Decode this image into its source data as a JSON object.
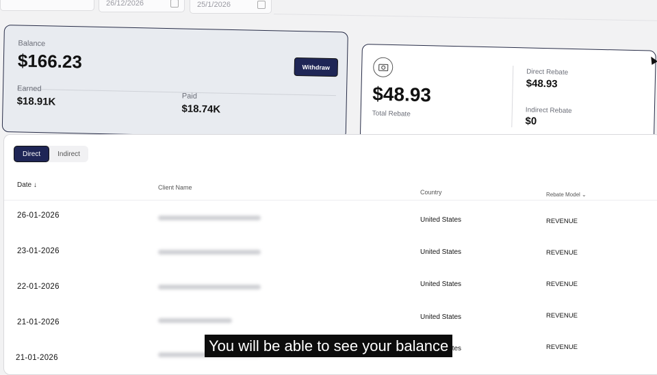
{
  "filters": {
    "start_date": "26/12/2026",
    "end_date": "25/1/2026"
  },
  "balance": {
    "label": "Balance",
    "amount": "$166.23",
    "withdraw_label": "Withdraw",
    "earned_label": "Earned",
    "earned_value": "$18.91K",
    "paid_label": "Paid",
    "paid_value": "$18.74K"
  },
  "rebate": {
    "total_value": "$48.93",
    "total_label": "Total Rebate",
    "direct_label": "Direct Rebate",
    "direct_value": "$48.93",
    "indirect_label": "Indirect Rebate",
    "indirect_value": "$0",
    "icon": "money-icon"
  },
  "tabs": [
    {
      "label": "Direct",
      "active": true
    },
    {
      "label": "Indirect",
      "active": false
    }
  ],
  "table": {
    "headers": {
      "date": "Date ↓",
      "client": "Client Name",
      "country": "Country",
      "model": "Rebate Model ⌄"
    },
    "rows": [
      {
        "date": "26-01-2026",
        "country": "United States",
        "model": "REVENUE"
      },
      {
        "date": "23-01-2026",
        "country": "United States",
        "model": "REVENUE"
      },
      {
        "date": "22-01-2026",
        "country": "United States",
        "model": "REVENUE"
      },
      {
        "date": "21-01-2026",
        "country": "United States",
        "model": "REVENUE"
      },
      {
        "date": "21-01-2026",
        "country": "United States",
        "model": "REVENUE"
      }
    ]
  },
  "caption": "You will be able to see your balance"
}
